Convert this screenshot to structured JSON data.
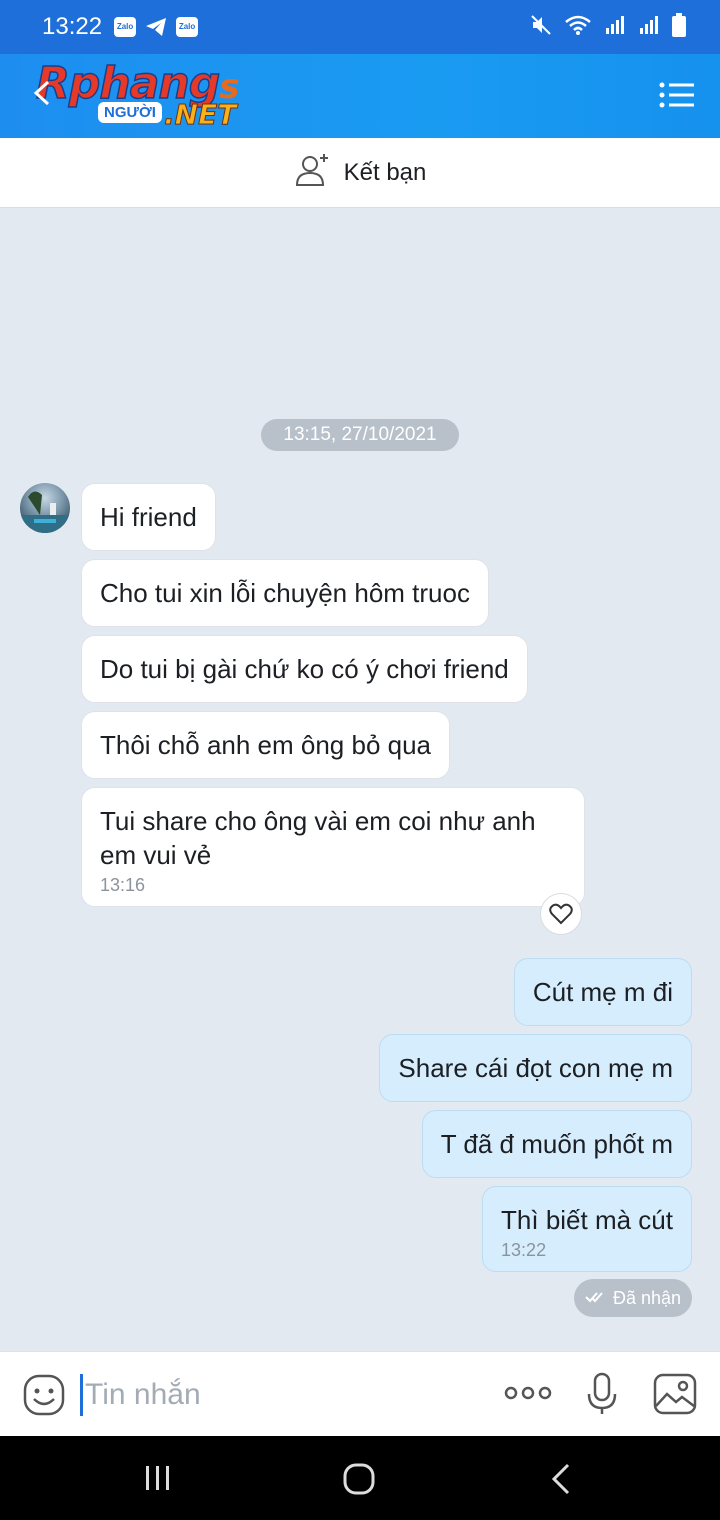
{
  "status_bar": {
    "time": "13:22",
    "app_icons": [
      "Zalo",
      "Zalo"
    ]
  },
  "header": {
    "logo_main": "Rphang",
    "logo_s": "s",
    "logo_sub": "NGƯỜI",
    "logo_net": ".NET"
  },
  "friend_bar": {
    "label": "Kết bạn"
  },
  "chat": {
    "date": "13:15, 27/10/2021",
    "incoming": [
      {
        "text": "Hi friend"
      },
      {
        "text": "Cho tui xin lỗi chuyện hôm truoc"
      },
      {
        "text": "Do tui bị gài chứ ko có ý chơi friend"
      },
      {
        "text": "Thôi chỗ anh em ông bỏ qua"
      },
      {
        "text": "Tui share cho ông vài em coi như anh em vui vẻ",
        "time": "13:16"
      }
    ],
    "outgoing": [
      {
        "text": "Cút mẹ m đi"
      },
      {
        "text": "Share cái đọt con mẹ m"
      },
      {
        "text": "T đã đ muốn phốt m"
      },
      {
        "text": "Thì biết mà cút",
        "time": "13:22"
      }
    ],
    "status": "Đã nhận"
  },
  "input": {
    "placeholder": "Tin nhắn"
  },
  "colors": {
    "header_blue": "#1a9bf2",
    "status_blue": "#1e6fd9",
    "out_bubble": "#d6edfd",
    "chat_bg": "#e2e9f1"
  }
}
